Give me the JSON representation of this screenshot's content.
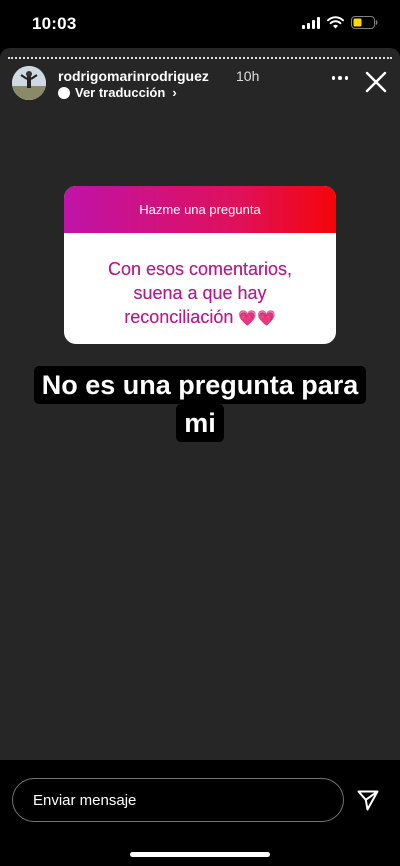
{
  "status_bar": {
    "time": "10:03"
  },
  "story": {
    "username": "rodrigomarinrodriguez",
    "time_ago": "10h",
    "translate_label": "Ver traducción"
  },
  "question_sticker": {
    "header": "Hazme una pregunta",
    "lines": [
      "Con esos comentarios,",
      "suena a que hay",
      "reconciliación"
    ],
    "emoji": "💗💗"
  },
  "response": {
    "lines": [
      "No es una pregunta para",
      "mi"
    ]
  },
  "message_bar": {
    "placeholder": "Enviar mensaje"
  }
}
